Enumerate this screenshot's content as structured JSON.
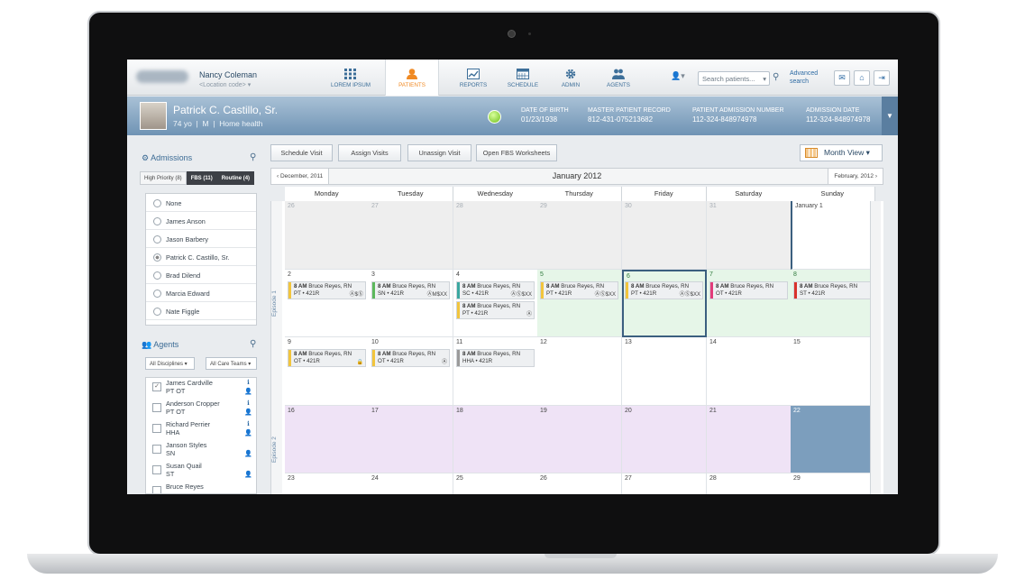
{
  "topnav": {
    "user_name": "Nancy Coleman",
    "location_code": "<Location code>",
    "items": [
      {
        "label": "LOREM IPSUM",
        "icon": "grid-icon"
      },
      {
        "label": "PATIENTS",
        "icon": "person-icon"
      },
      {
        "label": "REPORTS",
        "icon": "chart-icon"
      },
      {
        "label": "SCHEDULE",
        "icon": "calendar-icon"
      },
      {
        "label": "ADMIN",
        "icon": "gear-icon"
      },
      {
        "label": "AGENTS",
        "icon": "people-icon"
      }
    ],
    "search_placeholder": "Search patients...",
    "advanced_search_line1": "Advanced",
    "advanced_search_line2": "search",
    "active_color": "#f08a24"
  },
  "patient": {
    "name": "Patrick C. Castillo, Sr.",
    "age": "74 yo",
    "sex": "M",
    "service": "Home health",
    "fields": [
      {
        "label": "DATE OF BIRTH",
        "value": "01/23/1938"
      },
      {
        "label": "MASTER PATIENT RECORD",
        "value": "812-431-075213682"
      },
      {
        "label": "PATIENT ADMISSION NUMBER",
        "value": "112-324-848974978"
      },
      {
        "label": "ADMISSION DATE",
        "value": "112-324-848974978"
      }
    ]
  },
  "admissions": {
    "title": "Admissions",
    "tabs": [
      "High Priority (8)",
      "FBS (11)",
      "Routine (4)"
    ],
    "options": [
      "None",
      "James Anson",
      "Jason Barbery",
      "Patrick C. Castillo, Sr.",
      "Brad Dilend",
      "Marcia Edward",
      "Nate Figgle"
    ],
    "selected_index": 3
  },
  "agents": {
    "title": "Agents",
    "filter_disciplines": "All Disciplines",
    "filter_teams": "All Care Teams",
    "list": [
      {
        "name": "James Cardville",
        "disc": "PT OT",
        "checked": true
      },
      {
        "name": "Anderson Cropper",
        "disc": "PT OT",
        "checked": false
      },
      {
        "name": "Richard Perrier",
        "disc": "HHA",
        "checked": false
      },
      {
        "name": "Janson Styles",
        "disc": "SN",
        "checked": false
      },
      {
        "name": "Susan Quail",
        "disc": "ST",
        "checked": false
      },
      {
        "name": "Bruce Reyes",
        "disc": "",
        "checked": false
      }
    ]
  },
  "actions": {
    "schedule_visit": "Schedule Visit",
    "assign_visits": "Assign Visits",
    "unassign_visit": "Unassign Visit",
    "open_fbs": "Open FBS Worksheets",
    "month_view": "Month View"
  },
  "calendar": {
    "prev_month": "December, 2011",
    "current_month": "January 2012",
    "next_month": "February, 2012",
    "days": [
      "Monday",
      "Tuesday",
      "Wednesday",
      "Thursday",
      "Friday",
      "Saturday",
      "Sunday"
    ],
    "episode1": "Episode 1",
    "episode2": "Episode 2",
    "weeks": [
      [
        "26",
        "27",
        "28",
        "29",
        "30",
        "31",
        "January 1"
      ],
      [
        "2",
        "3",
        "4",
        "5",
        "6",
        "7",
        "8"
      ],
      [
        "9",
        "10",
        "11",
        "12",
        "13",
        "14",
        "15"
      ],
      [
        "16",
        "17",
        "18",
        "19",
        "20",
        "21",
        "22"
      ],
      [
        "23",
        "24",
        "25",
        "26",
        "27",
        "28",
        "29"
      ]
    ],
    "visits": [
      {
        "week": 1,
        "day": 0,
        "slot": 0,
        "time": "8 AM",
        "who": "Bruce Reyes, RN",
        "code": "PT • 421R",
        "icons": "Ⓐ$Ⓢ",
        "color": "#f2c53d"
      },
      {
        "week": 1,
        "day": 1,
        "slot": 0,
        "time": "8 AM",
        "who": "Bruce Reyes, RN",
        "code": "SN • 421R",
        "icons": "ⒶM$XX",
        "color": "#5cb85c"
      },
      {
        "week": 1,
        "day": 2,
        "slot": 0,
        "time": "8 AM",
        "who": "Bruce Reyes, RN",
        "code": "SC • 421R",
        "icons": "ⒶⓈ$XX",
        "color": "#3aa7a0"
      },
      {
        "week": 1,
        "day": 2,
        "slot": 1,
        "time": "8 AM",
        "who": "Bruce Reyes, RN",
        "code": "PT • 421R",
        "icons": "Ⓐ",
        "color": "#f2c53d"
      },
      {
        "week": 1,
        "day": 3,
        "slot": 0,
        "time": "8 AM",
        "who": "Bruce Reyes, RN",
        "code": "PT • 421R",
        "icons": "ⒶⓈ$XX",
        "color": "#f2c53d"
      },
      {
        "week": 1,
        "day": 4,
        "slot": 0,
        "time": "8 AM",
        "who": "Bruce Reyes, RN",
        "code": "PT • 421R",
        "icons": "ⒶⓈ$XX",
        "color": "#f2c53d"
      },
      {
        "week": 1,
        "day": 5,
        "slot": 0,
        "time": "8 AM",
        "who": "Bruce Reyes, RN",
        "code": "OT • 421R",
        "icons": "",
        "color": "#e23b7a"
      },
      {
        "week": 1,
        "day": 6,
        "slot": 0,
        "time": "8 AM",
        "who": "Bruce Reyes, RN",
        "code": "ST • 421R",
        "icons": "",
        "color": "#d9322c"
      },
      {
        "week": 2,
        "day": 0,
        "slot": 0,
        "time": "8 AM",
        "who": "Bruce Reyes, RN",
        "code": "OT • 421R",
        "icons": "🔒",
        "color": "#f2c53d"
      },
      {
        "week": 2,
        "day": 1,
        "slot": 0,
        "time": "8 AM",
        "who": "Bruce Reyes, RN",
        "code": "OT • 421R",
        "icons": "Ⓐ",
        "color": "#f2c53d"
      },
      {
        "week": 2,
        "day": 2,
        "slot": 0,
        "time": "8 AM",
        "who": "Bruce Reyes, RN",
        "code": "HHA • 421R",
        "icons": "",
        "color": "#9a9a9a"
      }
    ]
  }
}
